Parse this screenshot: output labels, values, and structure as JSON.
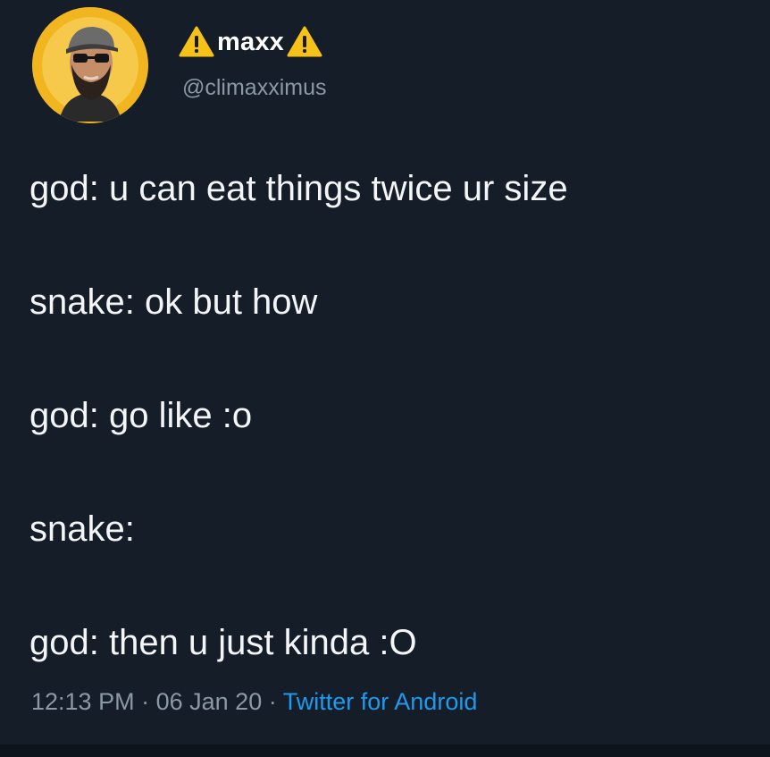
{
  "user": {
    "name": "maxx",
    "handle": "@climaxximus",
    "avatar_icon": "bearded-man-avatar",
    "name_icons": [
      "warning-icon",
      "warning-icon"
    ]
  },
  "tweet": {
    "lines": [
      "god: u can eat things twice ur size",
      "snake: ok but how",
      "god: go like :o",
      "snake:",
      "god: then u just kinda :O"
    ],
    "time": "12:13 PM",
    "separator": "·",
    "date": "06 Jan 20",
    "source": "Twitter for Android"
  },
  "colors": {
    "background": "#151d28",
    "text": "#f3f5f7",
    "secondary": "#8b98a5",
    "link": "#1d9bf0",
    "warning": "#f6c21a",
    "avatar_ring": "#f0b51f"
  }
}
